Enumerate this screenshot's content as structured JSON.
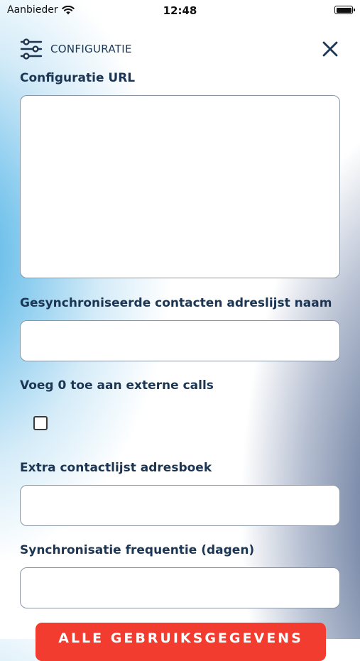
{
  "status_bar": {
    "carrier": "Aanbieder",
    "time": "12:48",
    "wifi_icon": "wifi-icon",
    "battery_icon": "battery-icon",
    "battery_level": 1.0
  },
  "header": {
    "icon": "sliders-icon",
    "title": "CONFIGURATIE",
    "close_icon": "close-icon"
  },
  "form": {
    "config_url": {
      "label": "Configuratie URL",
      "value": ""
    },
    "address_list_name": {
      "label": "Gesynchroniseerde contacten adreslijst naam",
      "value": ""
    },
    "add_zero": {
      "label": "Voeg 0 toe aan externe calls",
      "checked": false
    },
    "extra_address_book": {
      "label": "Extra contactlijst adresboek",
      "value": ""
    },
    "sync_frequency": {
      "label": "Synchronisatie frequentie (dagen)",
      "value": ""
    }
  },
  "actions": {
    "save_label": "ALLE GEBRUIKSGEGEVENS"
  },
  "colors": {
    "accent_text": "#1b3553",
    "button": "#f23c2f",
    "gradient_left": "#49b0e4",
    "gradient_right": "#54688a"
  }
}
